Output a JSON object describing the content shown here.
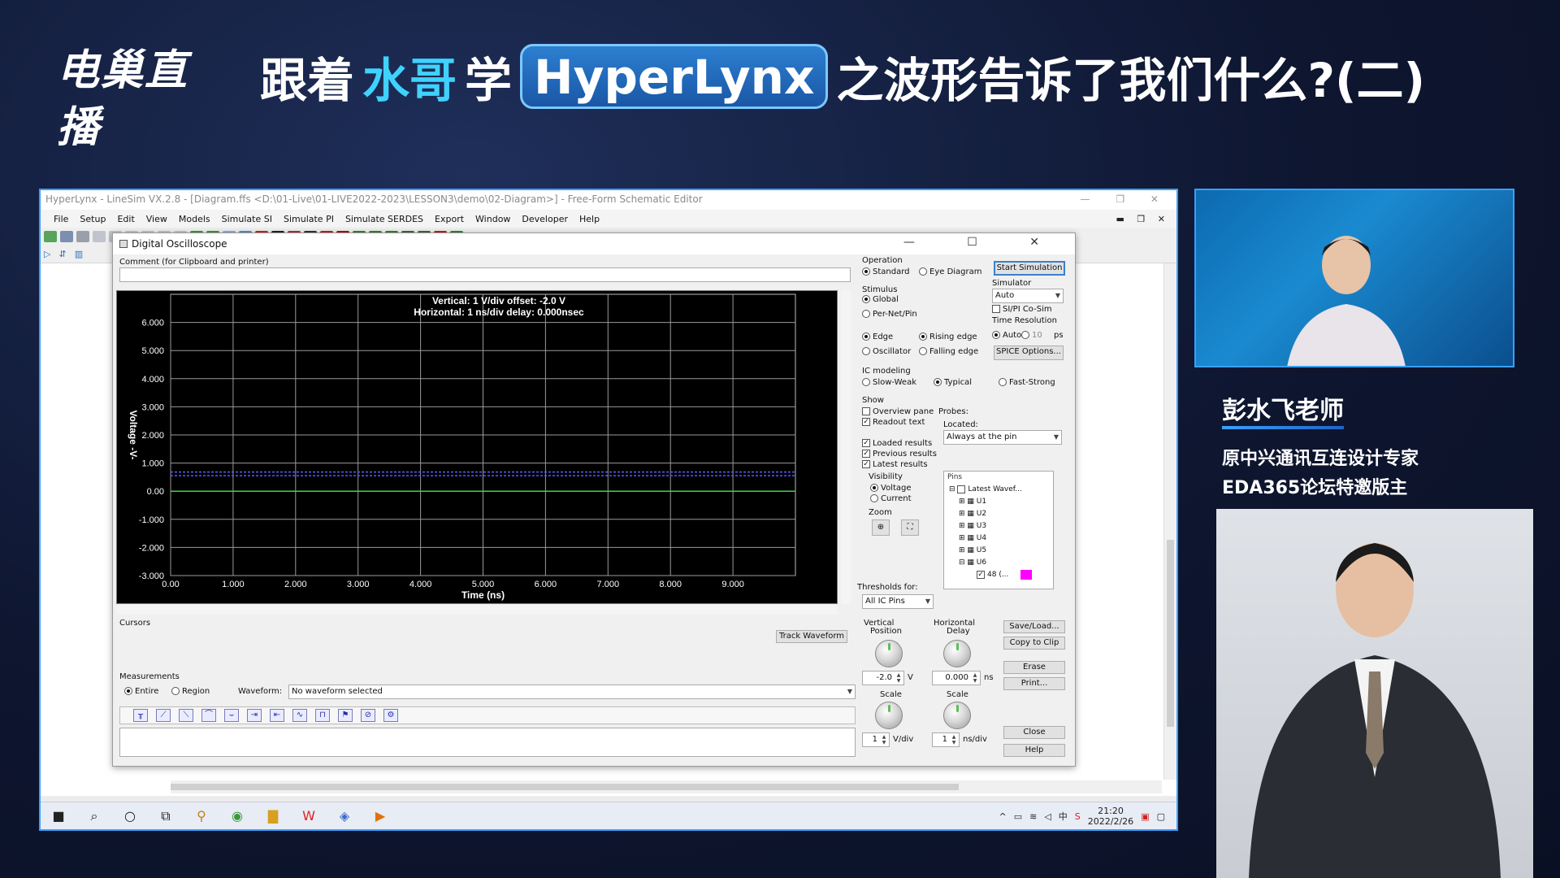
{
  "broadcast": {
    "logo_text": "电巢直播",
    "headline": {
      "part1": "跟着",
      "part2": "水哥",
      "part3": "学",
      "highlight": "HyperLynx",
      "part4": "之波形告诉了我们什么?(二)"
    },
    "teacher_name": "彭水飞老师",
    "bio_line1": "原中兴通讯互连设计专家",
    "bio_line2": "EDA365论坛特邀版主"
  },
  "app": {
    "title": "HyperLynx - LineSim VX.2.8 - [Diagram.ffs <D:\\01-Live\\01-LIVE2022-2023\\LESSON3\\demo\\02-Diagram>] - Free-Form Schematic Editor",
    "menu": [
      "File",
      "Setup",
      "Edit",
      "View",
      "Models",
      "Simulate SI",
      "Simulate PI",
      "Simulate SERDES",
      "Export",
      "Window",
      "Developer",
      "Help"
    ]
  },
  "dialog": {
    "title": "Digital Oscilloscope",
    "comment_label": "Comment (for Clipboard and printer)",
    "scope_header_line1": "Vertical: 1  V/div  offset: -2.0 V",
    "scope_header_line2": "Horizontal: 1 ns/div  delay: 0.000nsec",
    "cursors_label": "Cursors",
    "track_waveform_button": "Track Waveform",
    "measurements_label": "Measurements",
    "entire_label": "Entire",
    "region_label": "Region",
    "waveform_label": "Waveform:",
    "waveform_value": "No waveform selected",
    "operation_label": "Operation",
    "standard_label": "Standard",
    "eye_diagram_label": "Eye Diagram",
    "start_simulation_button": "Start Simulation",
    "stimulus_label": "Stimulus",
    "global_label": "Global",
    "per_net_pin_label": "Per-Net/Pin",
    "simulator_label": "Simulator",
    "simulator_value": "Auto",
    "si_pi_cosim_label": "SI/PI Co-Sim",
    "time_resolution_label": "Time Resolution",
    "auto_label": "Auto",
    "time_resolution_value": "10",
    "ps_label": "ps",
    "edge_label": "Edge",
    "oscillator_label": "Oscillator",
    "rising_edge_label": "Rising edge",
    "falling_edge_label": "Falling edge",
    "spice_options_button": "SPICE Options...",
    "ic_modeling_label": "IC modeling",
    "slow_weak_label": "Slow-Weak",
    "typical_label": "Typical",
    "fast_strong_label": "Fast-Strong",
    "show_label": "Show",
    "overview_pane_label": "Overview pane",
    "readout_text_label": "Readout text",
    "loaded_results_label": "Loaded results",
    "previous_results_label": "Previous results",
    "latest_results_label": "Latest results",
    "visibility_label": "Visibility",
    "voltage_label": "Voltage",
    "current_label": "Current",
    "zoom_label": "Zoom",
    "probes_label": "Probes:",
    "located_label": "Located:",
    "located_value": "Always at the pin",
    "pins_label": "Pins",
    "pins_tree": [
      "Latest Wavef...",
      "U1",
      "U2",
      "U3",
      "U4",
      "U5",
      "U6",
      "48 (..."
    ],
    "thresholds_label": "Thresholds for:",
    "thresholds_value": "All IC Pins",
    "vertical_position_label1": "Vertical",
    "vertical_position_label2": "Position",
    "vertical_position_value": "-2.0",
    "vertical_position_unit": "V",
    "horizontal_delay_label1": "Horizontal",
    "horizontal_delay_label2": "Delay",
    "horizontal_delay_value": "0.000",
    "horizontal_delay_unit": "ns",
    "scale_label": "Scale",
    "vertical_scale_value": "1",
    "vertical_scale_unit": "V/div",
    "horizontal_scale_value": "1",
    "horizontal_scale_unit": "ns/div",
    "save_load_button": "Save/Load...",
    "copy_to_clip_button": "Copy to Clip",
    "erase_button": "Erase",
    "print_button": "Print...",
    "close_button": "Close",
    "help_button": "Help"
  },
  "taskbar": {
    "time": "21:20",
    "date": "2022/2/26"
  },
  "colors": {
    "accent": "#3aa0ff",
    "headline_cyan": "#3fd2ff",
    "scope_bg": "#000000",
    "trace_green": "#3fd43f",
    "trace_blue": "#5a5aff",
    "pin_swatch": "#ff00ff"
  },
  "chart_data": {
    "type": "line",
    "xlabel": "Time  (ns)",
    "ylabel": "Voltage  -V-",
    "xlim": [
      0,
      10
    ],
    "ylim": [
      -3,
      7
    ],
    "x_ticks": [
      "0.00",
      "1.000",
      "2.000",
      "3.000",
      "4.000",
      "5.000",
      "6.000",
      "7.000",
      "8.000",
      "9.000"
    ],
    "y_ticks": [
      "6.000",
      "5.000",
      "4.000",
      "3.000",
      "2.000",
      "1.000",
      "0.00",
      "-1.000",
      "-2.000",
      "-3.000"
    ],
    "series": [
      {
        "color": "#3fd43f",
        "x": [
          0,
          10
        ],
        "y": [
          0.0,
          0.0
        ]
      },
      {
        "color": "#5a5aff",
        "x": [
          0,
          10
        ],
        "y": [
          0.55,
          0.55
        ]
      },
      {
        "color": "#5a5aff",
        "x": [
          0,
          10
        ],
        "y": [
          0.68,
          0.68
        ]
      }
    ],
    "grid": true
  }
}
